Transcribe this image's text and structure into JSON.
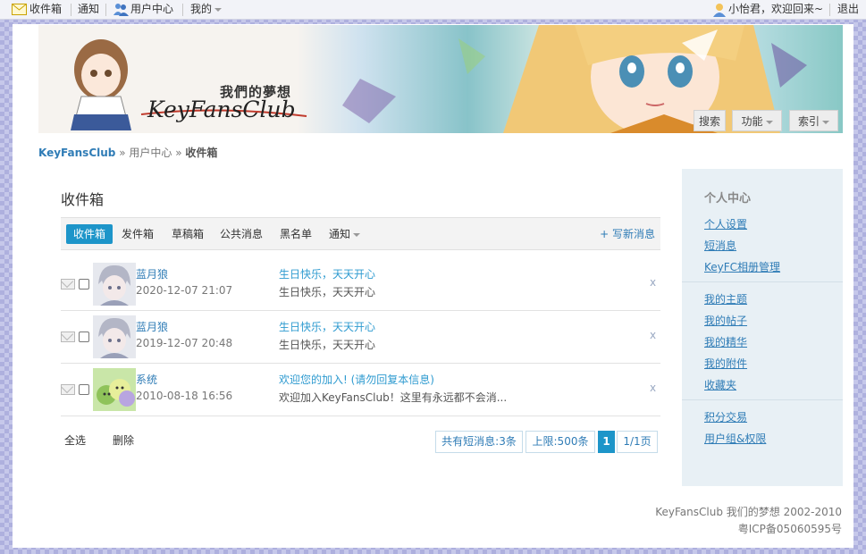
{
  "topbar": {
    "inbox": "收件箱",
    "notify": "通知",
    "usercenter": "用户中心",
    "mine": "我的",
    "welcome": "小怡君，欢迎回来~",
    "logout": "退出"
  },
  "banner": {
    "slogan": "我們的夢想",
    "logo": "KeyFansClub",
    "search": "搜索",
    "functions": "功能",
    "index": "索引"
  },
  "breadcrumb": {
    "home": "KeyFansClub",
    "sep1": "»",
    "parent": "用户中心",
    "sep2": "»",
    "current": "收件箱"
  },
  "page_title": "收件箱",
  "tabs": {
    "inbox": "收件箱",
    "outbox": "发件箱",
    "drafts": "草稿箱",
    "public": "公共消息",
    "blacklist": "黑名单",
    "notify": "通知",
    "compose": "+ 写新消息"
  },
  "messages": [
    {
      "sender": "蓝月狼",
      "date": "2020-12-07 21:07",
      "subject": "生日快乐，天天开心",
      "preview": "生日快乐，天天开心",
      "delete": "x"
    },
    {
      "sender": "蓝月狼",
      "date": "2019-12-07 20:48",
      "subject": "生日快乐，天天开心",
      "preview": "生日快乐，天天开心",
      "delete": "x"
    },
    {
      "sender": "系统",
      "date": "2010-08-18 16:56",
      "subject": "欢迎您的加入! (请勿回复本信息)",
      "preview": "欢迎加入KeyFansClub！这里有永远都不会消...",
      "delete": "x"
    }
  ],
  "actions": {
    "select_all": "全选",
    "delete": "删除"
  },
  "pager": {
    "total": "共有短消息:3条",
    "limit": "上限:500条",
    "current": "1",
    "pages": "1/1页"
  },
  "sidebar": {
    "heading": "个人中心",
    "group1": [
      "个人设置",
      "短消息",
      "KeyFC相册管理"
    ],
    "group2": [
      "我的主题",
      "我的帖子",
      "我的精华",
      "我的附件",
      "收藏夹"
    ],
    "group3": [
      "积分交易",
      "用户组&权限"
    ]
  },
  "footer": {
    "line1": "KeyFansClub 我们的梦想 2002-2010",
    "line2": "粤ICP备05060595号"
  },
  "colors": {
    "accent": "#1d95c9",
    "link": "#2f7cb6",
    "subject_link": "#2f9bd0",
    "sidebar_bg": "#e8f0f5"
  }
}
